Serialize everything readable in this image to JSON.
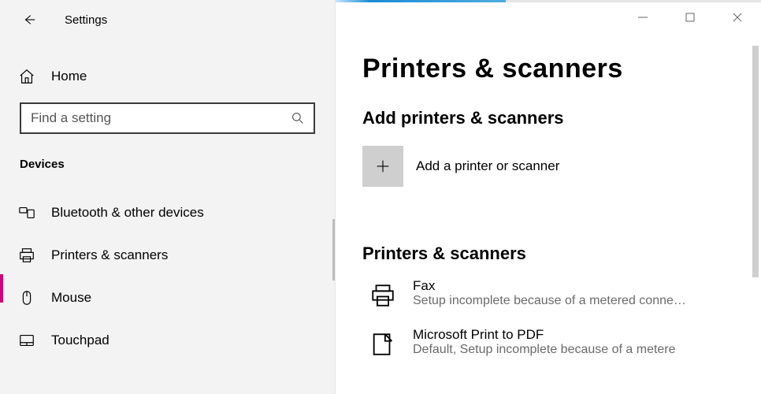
{
  "app": {
    "title": "Settings"
  },
  "sidebar": {
    "home_label": "Home",
    "search_placeholder": "Find a setting",
    "category": "Devices",
    "items": [
      {
        "icon": "bluetooth",
        "label": "Bluetooth & other devices"
      },
      {
        "icon": "printer",
        "label": "Printers & scanners"
      },
      {
        "icon": "mouse",
        "label": "Mouse"
      },
      {
        "icon": "touchpad",
        "label": "Touchpad"
      }
    ],
    "active_index": 1
  },
  "main": {
    "title": "Printers & scanners",
    "section_add": {
      "heading": "Add printers & scanners",
      "button_label": "Add a printer or scanner"
    },
    "section_list": {
      "heading": "Printers & scanners",
      "devices": [
        {
          "name": "Fax",
          "sub": "Setup incomplete because of a metered conne…",
          "icon": "printer"
        },
        {
          "name": "Microsoft Print to PDF",
          "sub": "Default, Setup incomplete because of a metere",
          "icon": "pdf-printer"
        }
      ]
    }
  },
  "colors": {
    "accent": "#d40078"
  }
}
